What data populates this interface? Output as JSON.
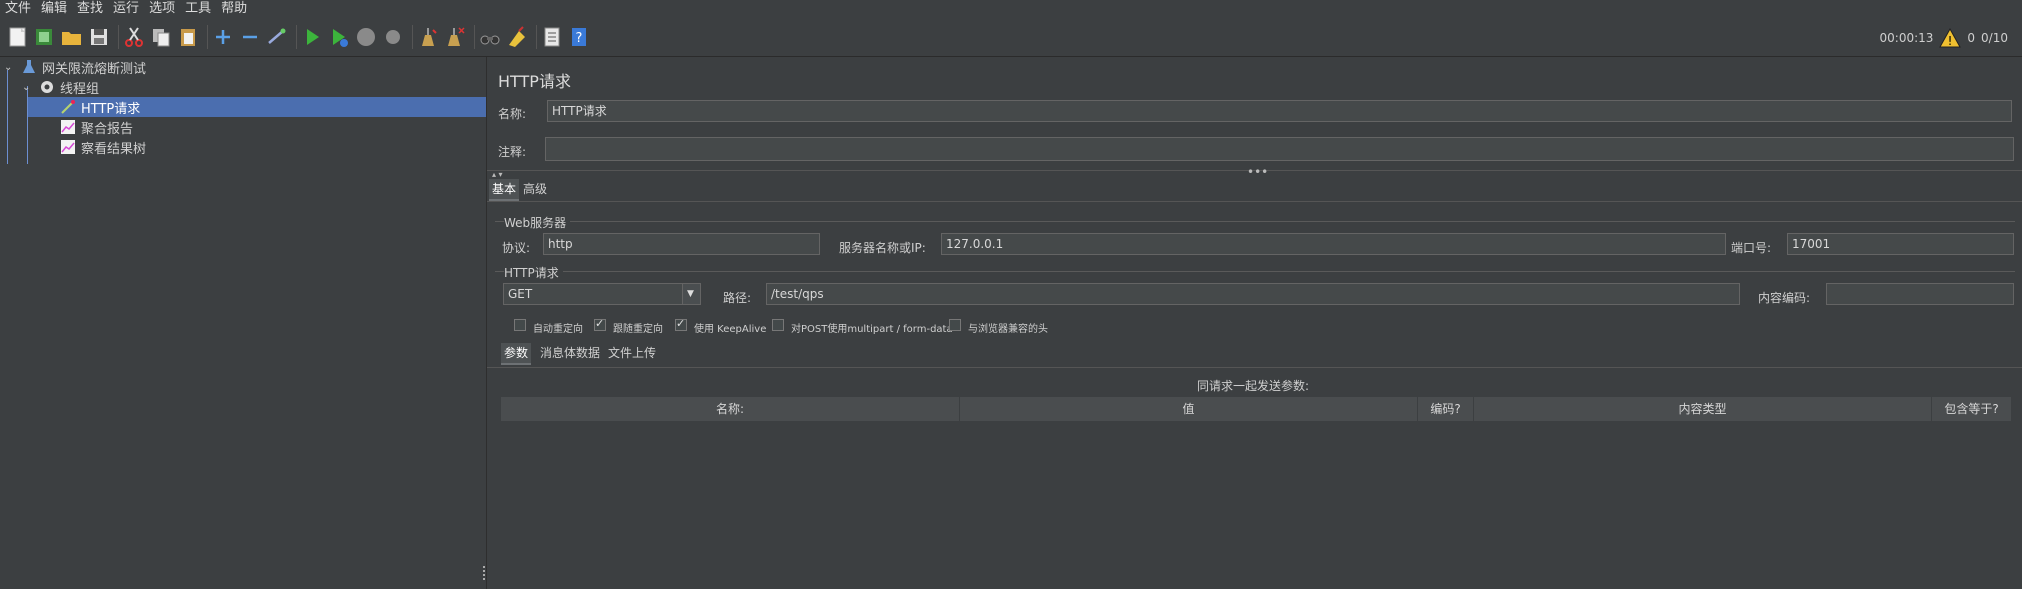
{
  "menu": [
    "文件",
    "编辑",
    "查找",
    "运行",
    "选项",
    "工具",
    "帮助"
  ],
  "toolbar": {
    "icons": [
      "new-icon",
      "templates-icon",
      "open-icon",
      "save-icon",
      "cut-icon",
      "copy-icon",
      "paste-icon",
      "expand-icon",
      "collapse-icon",
      "toggle-icon",
      "start-icon",
      "start-no-pause-icon",
      "stop-icon",
      "shutdown-icon",
      "clear-icon",
      "clear-all-icon",
      "search-icon",
      "reset-search-icon",
      "function-helper-icon",
      "help-icon"
    ]
  },
  "status": {
    "elapsed": "00:00:13",
    "warnings": "0",
    "threads": "0/10"
  },
  "tree": {
    "root": "网关限流熔断测试",
    "group": "线程组",
    "items": [
      "HTTP请求",
      "聚合报告",
      "察看结果树"
    ]
  },
  "panel": {
    "title": "HTTP请求",
    "name_label": "名称:",
    "name_value": "HTTP请求",
    "comment_label": "注释:",
    "comment_value": "",
    "tabs": [
      "基本",
      "高级"
    ],
    "web_server": {
      "title": "Web服务器",
      "protocol_label": "协议:",
      "protocol_value": "http",
      "server_label": "服务器名称或IP:",
      "server_value": "127.0.0.1",
      "port_label": "端口号:",
      "port_value": "17001"
    },
    "http_request": {
      "title": "HTTP请求",
      "method": "GET",
      "path_label": "路径:",
      "path_value": "/test/qps",
      "encoding_label": "内容编码:",
      "encoding_value": ""
    },
    "checkboxes": [
      {
        "label": "自动重定向",
        "checked": false
      },
      {
        "label": "跟随重定向",
        "checked": true
      },
      {
        "label": "使用 KeepAlive",
        "checked": true
      },
      {
        "label": "对POST使用multipart / form-data",
        "checked": false
      },
      {
        "label": "与浏览器兼容的头",
        "checked": false
      }
    ],
    "sub_tabs": [
      "参数",
      "消息体数据",
      "文件上传"
    ],
    "params_caption": "同请求一起发送参数:",
    "columns": [
      "名称:",
      "值",
      "编码?",
      "内容类型",
      "包含等于?"
    ]
  }
}
